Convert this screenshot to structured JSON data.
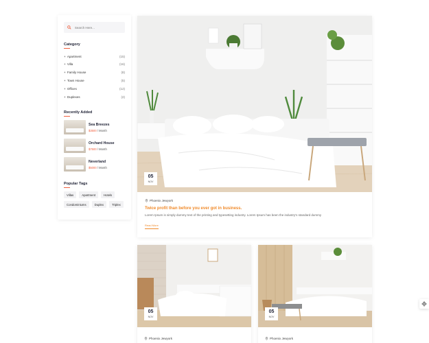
{
  "search": {
    "placeholder": "Search Here..."
  },
  "category": {
    "title": "Category",
    "items": [
      {
        "label": "Apartment",
        "count": "(15)"
      },
      {
        "label": "Villa",
        "count": "(16)"
      },
      {
        "label": "Family House",
        "count": "(8)"
      },
      {
        "label": "Town House",
        "count": "(5)"
      },
      {
        "label": "Offices",
        "count": "(12)"
      },
      {
        "label": "Duplexes",
        "count": "(2)"
      }
    ]
  },
  "recent": {
    "title": "Recently Added",
    "items": [
      {
        "title": "Sea Breezes",
        "price": "$3500",
        "unit": " / Month"
      },
      {
        "title": "Orchard House",
        "price": "$7500",
        "unit": " / Month"
      },
      {
        "title": "Neverland",
        "price": "$5000",
        "unit": " / Month"
      }
    ]
  },
  "tags": {
    "title": "Popular Tags",
    "items": [
      "Villas",
      "Apartment",
      "Hotels",
      "Condominiums",
      "Duplex",
      "Triplex"
    ]
  },
  "main_post": {
    "day": "05",
    "month": "NOV",
    "location": "Phoenix Jewyork",
    "title": "Twice profit than before you ever got in business.",
    "excerpt": "Lorem Ipsum is simply dummy text of the printing and typesetting industry. Lorem Ipsum has been the industry's standard dummy",
    "read_more": "Read More"
  },
  "posts": [
    {
      "day": "05",
      "month": "NOV",
      "location": "Phoenix Jewyork"
    },
    {
      "day": "05",
      "month": "NOV",
      "location": "Phoenix Jewyork"
    }
  ],
  "colors": {
    "accent": "#f08a2a",
    "underline": "#f0603f",
    "dark": "#1f2235"
  },
  "icons": {
    "search": "search-icon",
    "location": "map-pin-icon",
    "settings": "gear-icon"
  }
}
